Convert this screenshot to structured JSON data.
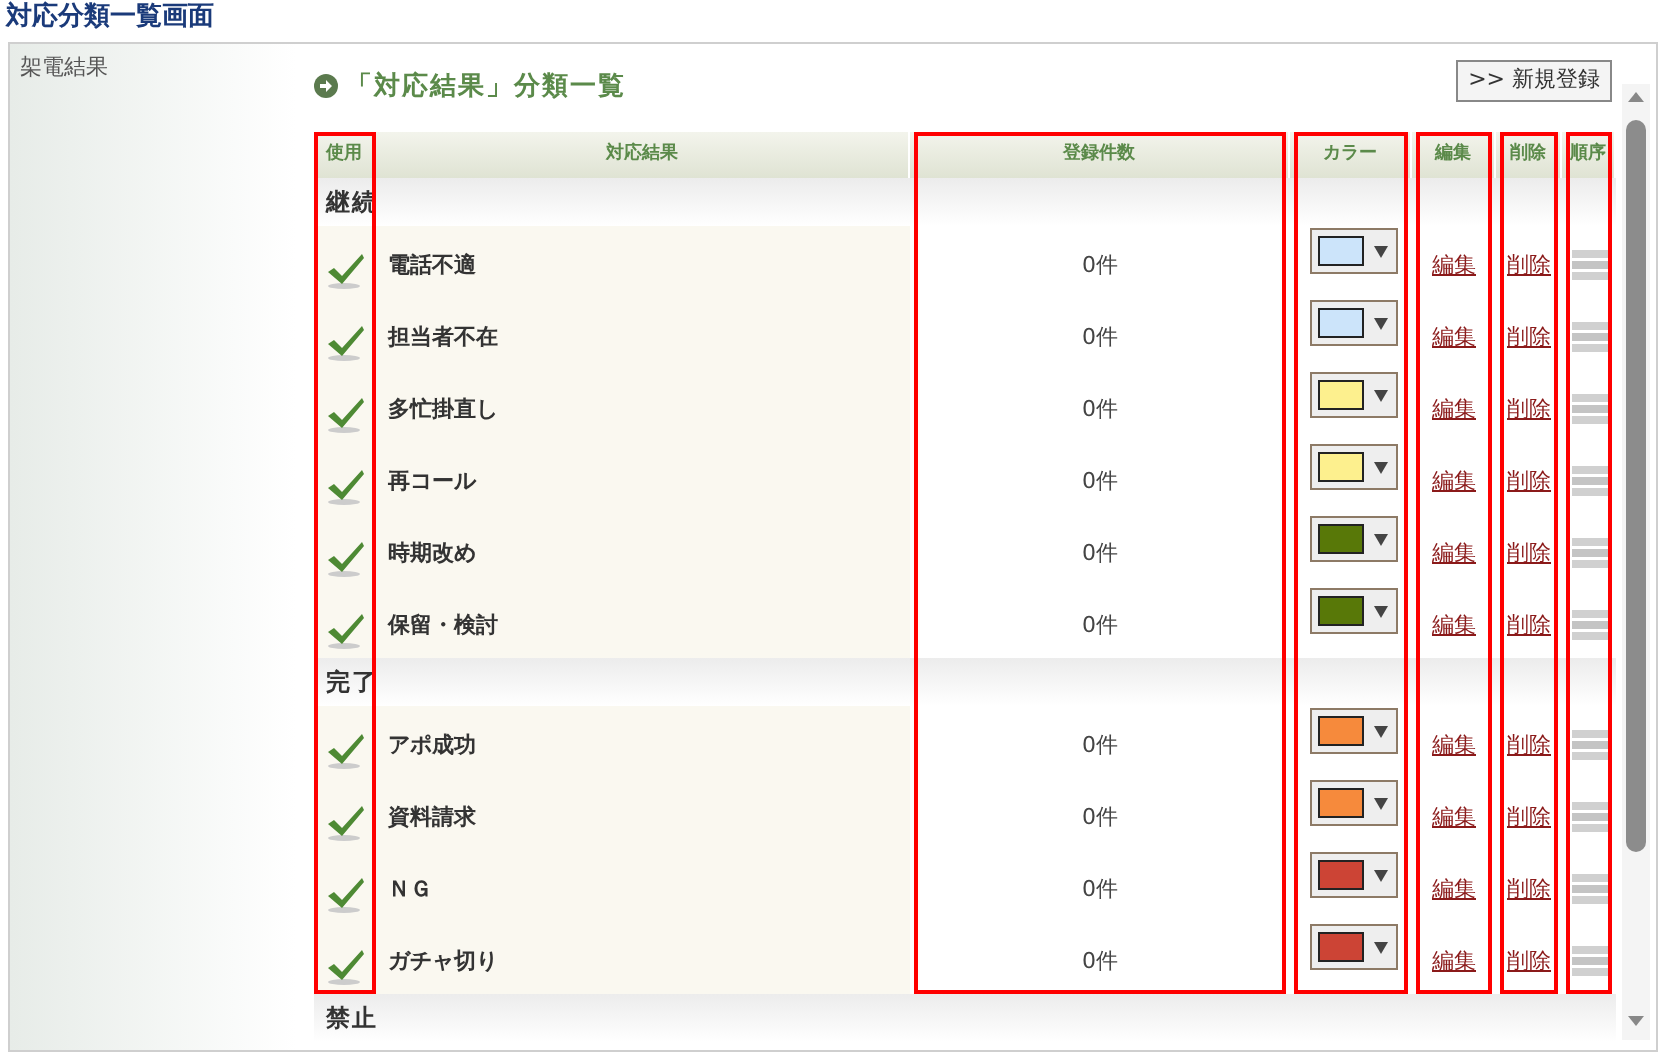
{
  "page_title": "対応分類一覧画面",
  "sidebar": {
    "items": [
      {
        "label": "架電結果"
      }
    ]
  },
  "section": {
    "title": "「対応結果」分類一覧",
    "new_button": ">> 新規登録"
  },
  "table": {
    "columns": [
      {
        "label": "使用",
        "highlighted": true
      },
      {
        "label": "対応結果",
        "highlighted": false
      },
      {
        "label": "登録件数",
        "highlighted": true
      },
      {
        "label": "カラー",
        "highlighted": true
      },
      {
        "label": "編集",
        "highlighted": true
      },
      {
        "label": "削除",
        "highlighted": true
      },
      {
        "label": "順序",
        "highlighted": true
      }
    ],
    "groups": [
      {
        "label": "継続",
        "rows": [
          {
            "name": "電話不適",
            "used": true,
            "count": "0件",
            "color": "#cce4fa",
            "edit": "編集",
            "delete": "削除"
          },
          {
            "name": "担当者不在",
            "used": true,
            "count": "0件",
            "color": "#cce4fa",
            "edit": "編集",
            "delete": "削除"
          },
          {
            "name": "多忙掛直し",
            "used": true,
            "count": "0件",
            "color": "#fdf08e",
            "edit": "編集",
            "delete": "削除"
          },
          {
            "name": "再コール",
            "used": true,
            "count": "0件",
            "color": "#fdf08e",
            "edit": "編集",
            "delete": "削除"
          },
          {
            "name": "時期改め",
            "used": true,
            "count": "0件",
            "color": "#587808",
            "edit": "編集",
            "delete": "削除"
          },
          {
            "name": "保留・検討",
            "used": true,
            "count": "0件",
            "color": "#587808",
            "edit": "編集",
            "delete": "削除"
          }
        ]
      },
      {
        "label": "完了",
        "rows": [
          {
            "name": "アポ成功",
            "used": true,
            "count": "0件",
            "color": "#f68a3c",
            "edit": "編集",
            "delete": "削除"
          },
          {
            "name": "資料請求",
            "used": true,
            "count": "0件",
            "color": "#f68a3c",
            "edit": "編集",
            "delete": "削除"
          },
          {
            "name": "ＮＧ",
            "used": true,
            "count": "0件",
            "color": "#cc4435",
            "edit": "編集",
            "delete": "削除"
          },
          {
            "name": "ガチャ切り",
            "used": true,
            "count": "0件",
            "color": "#cc4435",
            "edit": "編集",
            "delete": "削除"
          }
        ]
      },
      {
        "label": "禁止"
      }
    ]
  }
}
